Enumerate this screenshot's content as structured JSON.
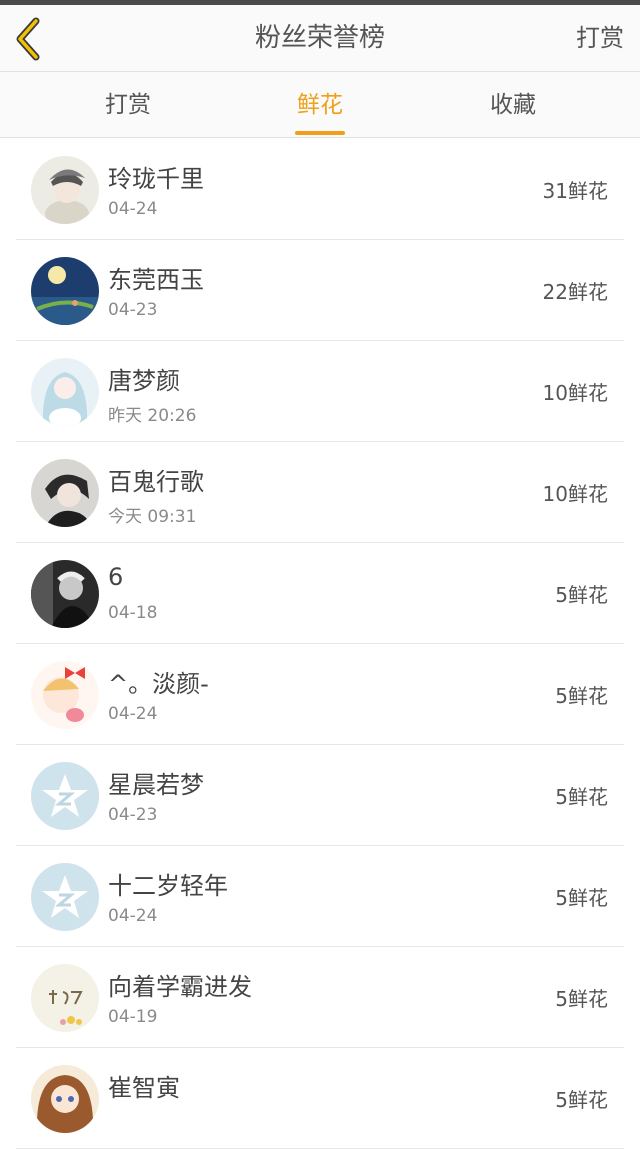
{
  "header": {
    "title": "粉丝荣誉榜",
    "action_label": "打赏",
    "back_icon": "chevron-left-icon",
    "accent_color": "#f0a018"
  },
  "tabs": [
    {
      "label": "打赏",
      "active": false
    },
    {
      "label": "鲜花",
      "active": true
    },
    {
      "label": "收藏",
      "active": false
    }
  ],
  "fans": [
    {
      "name": "玲珑千里",
      "date": "04-24",
      "amount": "31鲜花",
      "avatar": "anime-boy-hat"
    },
    {
      "name": "东莞西玉",
      "date": "04-23",
      "amount": "22鲜花",
      "avatar": "night-moon"
    },
    {
      "name": "唐梦颜",
      "date": "昨天 20:26",
      "amount": "10鲜花",
      "avatar": "anime-girl-blue"
    },
    {
      "name": "百鬼行歌",
      "date": "今天 09:31",
      "amount": "10鲜花",
      "avatar": "anime-boy-dark"
    },
    {
      "name": "6",
      "date": "04-18",
      "amount": "5鲜花",
      "avatar": "photo-bw"
    },
    {
      "name": "^。淡颜-",
      "date": "04-24",
      "amount": "5鲜花",
      "avatar": "cartoon-girl-bow"
    },
    {
      "name": "星晨若梦",
      "date": "04-23",
      "amount": "5鲜花",
      "avatar": "default-qq-star"
    },
    {
      "name": "十二岁轻年",
      "date": "04-24",
      "amount": "5鲜花",
      "avatar": "default-qq-star"
    },
    {
      "name": "向着学霸进发",
      "date": "04-19",
      "amount": "5鲜花",
      "avatar": "calligraphy-flowers"
    },
    {
      "name": "崔智寅",
      "date": "",
      "amount": "5鲜花",
      "avatar": "anime-girl-brown"
    }
  ]
}
